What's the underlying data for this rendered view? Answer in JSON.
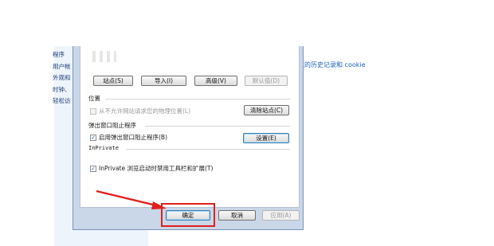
{
  "background": {
    "left_links": [
      "程序",
      "用户帐",
      "外观和",
      "时钟、",
      "轻松访"
    ],
    "right_link": "览的历史记录和 cookie"
  },
  "dialog": {
    "buttons_top": {
      "sites": "站点(S)",
      "import": "导入(I)",
      "advanced": "高级(V)",
      "default": "默认值(D)"
    },
    "location": {
      "heading": "位置",
      "checkbox_label": "从不允许网站请求您的物理位置(L)",
      "checked": false,
      "clear_button": "清除站点(C)"
    },
    "popup": {
      "heading": "弹出窗口阻止程序",
      "checkbox_label": "启用弹出窗口阻止程序(B)",
      "checked": true,
      "settings_button": "设置(E)"
    },
    "inprivate": {
      "heading": "InPrivate",
      "checkbox_label": "InPrivate 浏览启动时禁用工具栏和扩展(T)",
      "checked": true
    },
    "footer": {
      "ok": "确定",
      "cancel": "取消",
      "apply": "应用(A)"
    }
  },
  "colors": {
    "highlight": "#e0201e",
    "dialog_frame": "#c9d7e8",
    "link": "#1f5fbf"
  }
}
